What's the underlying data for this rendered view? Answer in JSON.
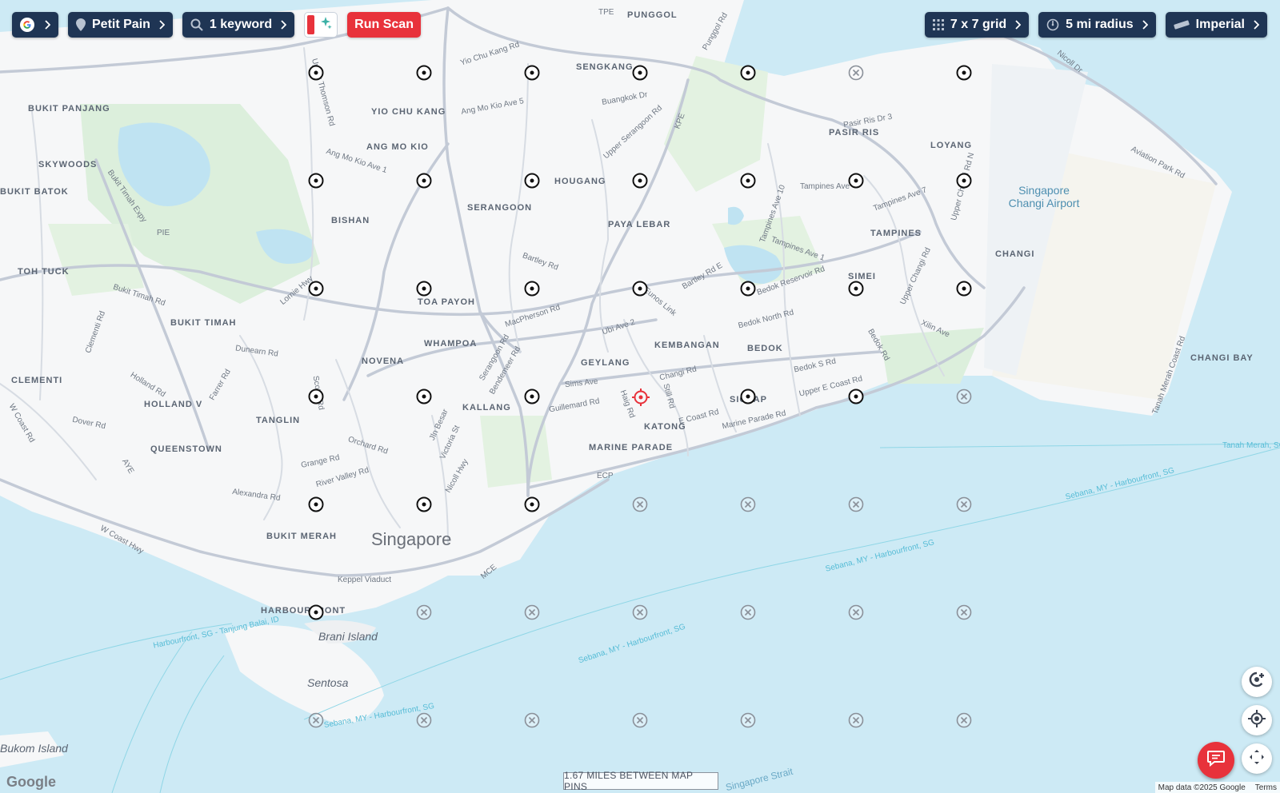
{
  "toolbar": {
    "search_engine_icon": "google-g-icon",
    "business": "Petit Pain",
    "keywords": "1 keyword",
    "run_label": "Run Scan",
    "grid": "7 x 7 grid",
    "radius": "5 mi radius",
    "units": "Imperial"
  },
  "colors": {
    "toolbar_bg": "#1f3554",
    "accent_red": "#e8323b",
    "water": "#cdeaf5",
    "land": "#f6f7f8",
    "park": "#dcefdc"
  },
  "labels": {
    "punggol": "PUNGGOL",
    "sengkang": "SENGKANG",
    "yio_chu_kang": "YIO CHU KANG",
    "ang_mo_kio": "ANG MO KIO",
    "bukit_panjang": "BUKIT PANJANG",
    "skywoods": "SKYWOODS",
    "bukit_batok": "BUKIT BATOK",
    "bishan": "BISHAN",
    "serangoon": "SERANGOON",
    "hougang": "HOUGANG",
    "paya_lebar": "PAYA LEBAR",
    "pasir_ris": "PASIR RIS",
    "loyang": "LOYANG",
    "tampines": "TAMPINES",
    "changi": "CHANGI",
    "simei": "SIMEI",
    "toh_tuck": "TOH TUCK",
    "toa_payoh": "TOA PAYOH",
    "bukit_timah": "BUKIT TIMAH",
    "whampoa": "WHAMPOA",
    "novena": "NOVENA",
    "geylang": "GEYLANG",
    "kembangan": "KEMBANGAN",
    "bedok": "BEDOK",
    "clementi": "CLEMENTI",
    "holland_v": "HOLLAND V",
    "tanglin": "TANGLIN",
    "kallang": "KALLANG",
    "katong": "KATONG",
    "siglap": "SIGLAP",
    "marine_parade": "MARINE PARADE",
    "queenstown": "QUEENSTOWN",
    "bukit_merah": "BUKIT MERAH",
    "singapore": "Singapore",
    "harbourfront": "HARBOURFRONT",
    "brani": "Brani Island",
    "sentosa": "Sentosa",
    "bukom": "Bukom Island",
    "airport": "Singapore Changi Airport",
    "changi_bay": "CHANGI BAY",
    "singapore_strait": "Singapore Strait"
  },
  "roads": {
    "tpe": "TPE",
    "yio_chu_kang_rd": "Yio Chu Kang Rd",
    "punggol_rd": "Punggol Rd",
    "upper_thomson_rd": "Upper Thomson Rd",
    "amk_ave5": "Ang Mo Kio Ave 5",
    "buangkok_dr": "Buangkok Dr",
    "upper_serangoon_rd": "Upper Serangoon Rd",
    "kpe": "KPE",
    "amk_ave1": "Ang Mo Kio Ave 1",
    "bukit_timah_expy": "Bukit Timah Expy",
    "pie": "PIE",
    "bukit_timah_rd": "Bukit Timah Rd",
    "lornie_hwy": "Lornie Hwy",
    "bartley_rd": "Bartley Rd",
    "tampines_ave10": "Tampines Ave 10",
    "tampines_ave": "Tampines Ave",
    "tampines_ave7": "Tampines Ave 7",
    "tampines_ave1": "Tampines Ave 1",
    "bedok_reservoir_rd": "Bedok Reservoir Rd",
    "pasir_ris_dr3": "Pasir Ris Dr 3",
    "upper_changi_rd": "Upper Changi Rd",
    "upper_changi_rd_n": "Upper Changi Rd N",
    "aviation_park_rd": "Aviation Park Rd",
    "nicoll_dr": "Nicoll Dr",
    "macpherson_rd": "MacPherson Rd",
    "ubi_ave2": "Ubi Ave 2",
    "eunos_link": "Eunos Link",
    "bartley_rd_e": "Bartley Rd E",
    "bedok_north_rd": "Bedok North Rd",
    "xilin_ave": "Xilin Ave",
    "dunearn_rd": "Dunearn Rd",
    "clementi_rd": "Clementi Rd",
    "holland_rd": "Holland Rd",
    "farrer_rd": "Farrer Rd",
    "dover_rd": "Dover Rd",
    "w_coast_rd": "W Coast Rd",
    "serangoon_rd": "Serangoon Rd",
    "bendemeer_rd": "Bendemeer Rd",
    "sims_ave": "Sims Ave",
    "guillemard_rd": "Guillemard Rd",
    "changi_rd": "Changi Rd",
    "haig_rd": "Haig Rd",
    "still_rd": "Still Rd",
    "bedok_s_rd": "Bedok S Rd",
    "upper_e_coast_rd": "Upper E Coast Rd",
    "bedok_rise": "Bedok Rd",
    "e_coast_rd": "E Coast Rd",
    "marine_parade_rd": "Marine Parade Rd",
    "ecp": "ECP",
    "scotts_rd": "Scotts Rd",
    "orchard_rd": "Orchard Rd",
    "grange_rd": "Grange Rd",
    "river_valley_rd": "River Valley Rd",
    "jln_besar": "Jln Besar",
    "victoria_st": "Victoria St",
    "nicoll_hwy": "Nicoll Hwy",
    "alexandra_rd": "Alexandra Rd",
    "aye": "AYE",
    "w_coast_hwy": "W Coast Hwy",
    "keppel_viaduct": "Keppel Viaduct",
    "mce": "MCE",
    "tanah_merah_coast_rd": "Tanah Merah Coast Rd",
    "ferry1": "Sebana, MY - Harbourfront, SG",
    "ferry2": "Harbourfront, SG - Tanjung Balai, ID",
    "ferry3": "Tanah Merah, SG"
  },
  "scale": "1.67 MILES BETWEEN MAP PINS",
  "attribution": {
    "map_data": "Map data ©2025 Google",
    "terms": "Terms",
    "google": "Google"
  },
  "grid": {
    "rows": 7,
    "cols": 7,
    "center": {
      "row": 3,
      "col": 3
    },
    "pins": [
      [
        "active",
        "active",
        "active",
        "active",
        "active",
        "inactive",
        "active"
      ],
      [
        "active",
        "active",
        "active",
        "active",
        "active",
        "active",
        "active"
      ],
      [
        "active",
        "active",
        "active",
        "active",
        "active",
        "active",
        "active"
      ],
      [
        "active",
        "active",
        "active",
        "center",
        "active",
        "active",
        "inactive"
      ],
      [
        "active",
        "active",
        "active",
        "inactive",
        "inactive",
        "inactive",
        "inactive"
      ],
      [
        "active",
        "inactive",
        "inactive",
        "inactive",
        "inactive",
        "inactive",
        "inactive"
      ],
      [
        "inactive",
        "inactive",
        "inactive",
        "inactive",
        "inactive",
        "inactive",
        "inactive"
      ]
    ]
  },
  "controls": [
    "map-pin-add-icon",
    "my-location-icon",
    "fullscreen-icon",
    "chat-icon"
  ]
}
